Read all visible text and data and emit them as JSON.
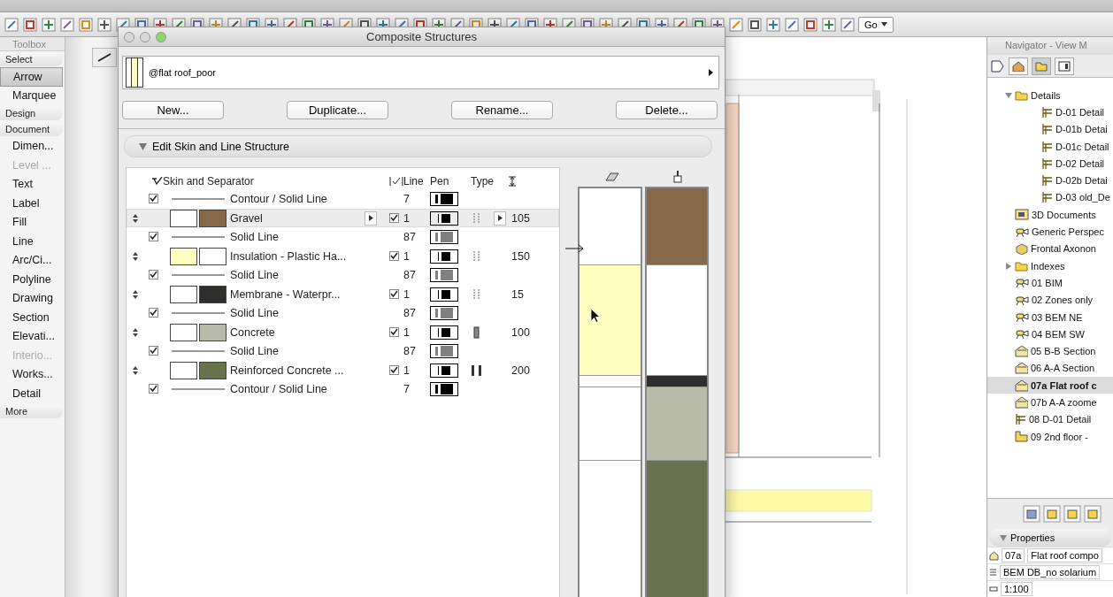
{
  "toolbar": {
    "go_button": "Go"
  },
  "toolbox": {
    "title": "Toolbox",
    "items": [
      {
        "kind": "group",
        "label": "Select"
      },
      {
        "kind": "tool",
        "label": "Arrow",
        "selected": true,
        "disabled": false
      },
      {
        "kind": "tool",
        "label": "Marquee",
        "selected": false,
        "disabled": false
      },
      {
        "kind": "group",
        "label": "Design"
      },
      {
        "kind": "group",
        "label": "Document"
      },
      {
        "kind": "tool",
        "label": "Dimen...",
        "selected": false,
        "disabled": false
      },
      {
        "kind": "tool",
        "label": "Level ...",
        "selected": false,
        "disabled": true
      },
      {
        "kind": "tool",
        "label": "Text",
        "selected": false,
        "disabled": false
      },
      {
        "kind": "tool",
        "label": "Label",
        "selected": false,
        "disabled": false
      },
      {
        "kind": "tool",
        "label": "Fill",
        "selected": false,
        "disabled": false
      },
      {
        "kind": "tool",
        "label": "Line",
        "selected": false,
        "disabled": false
      },
      {
        "kind": "tool",
        "label": "Arc/Ci...",
        "selected": false,
        "disabled": false
      },
      {
        "kind": "tool",
        "label": "Polyline",
        "selected": false,
        "disabled": false
      },
      {
        "kind": "tool",
        "label": "Drawing",
        "selected": false,
        "disabled": false
      },
      {
        "kind": "tool",
        "label": "Section",
        "selected": false,
        "disabled": false
      },
      {
        "kind": "tool",
        "label": "Elevati...",
        "selected": false,
        "disabled": false
      },
      {
        "kind": "tool",
        "label": "Interio...",
        "selected": false,
        "disabled": true
      },
      {
        "kind": "tool",
        "label": "Works...",
        "selected": false,
        "disabled": false
      },
      {
        "kind": "tool",
        "label": "Detail",
        "selected": false,
        "disabled": false
      },
      {
        "kind": "group",
        "label": "More"
      }
    ]
  },
  "dialog": {
    "title": "Composite Structures",
    "structure": "@flat roof_poor",
    "buttons": [
      "New...",
      "Duplicate...",
      "Rename...",
      "Delete..."
    ],
    "section": {
      "label": "Edit Skin and Line Structure",
      "expanded": true
    },
    "columns": {
      "name": "Skin and Separator",
      "line": "Line",
      "pen": "Pen",
      "type": "Type"
    },
    "rows": [
      {
        "kind": "line",
        "name": "Contour /  Solid Line",
        "checked": true,
        "line": "7",
        "pen": {
          "color": "#000000"
        }
      },
      {
        "kind": "skin",
        "name": "Gravel",
        "swatches": [
          {
            "color": "#ffffff"
          },
          {
            "color": "#86694a"
          }
        ],
        "checked": true,
        "line": "1",
        "pen": {
          "color": "#000000"
        },
        "pattern": {
          "kind": "hatch"
        },
        "thickness": "105",
        "selected": true
      },
      {
        "kind": "line",
        "name": "Solid Line",
        "checked": true,
        "line": "87",
        "pen": {
          "color": "#808080"
        }
      },
      {
        "kind": "skin",
        "name": "Insulation - Plastic Ha...",
        "swatches": [
          {
            "color": "#fffec0"
          },
          {
            "color": "#ffffff"
          }
        ],
        "checked": true,
        "line": "1",
        "pen": {
          "color": "#000000"
        },
        "pattern": {
          "kind": "hatch"
        },
        "thickness": "150",
        "selected": false
      },
      {
        "kind": "line",
        "name": "Solid Line",
        "checked": true,
        "line": "87",
        "pen": {
          "color": "#808080"
        }
      },
      {
        "kind": "skin",
        "name": "Membrane - Waterpr...",
        "swatches": [
          {
            "color": "#ffffff"
          },
          {
            "color": "#2e2e2c"
          }
        ],
        "checked": true,
        "line": "1",
        "pen": {
          "color": "#000000"
        },
        "pattern": {
          "kind": "hatch"
        },
        "thickness": "15",
        "selected": false
      },
      {
        "kind": "line",
        "name": "Solid Line",
        "checked": true,
        "line": "87",
        "pen": {
          "color": "#808080"
        }
      },
      {
        "kind": "skin",
        "name": "Concrete",
        "swatches": [
          {
            "color": "#ffffff"
          },
          {
            "color": "#b8baaa"
          }
        ],
        "checked": true,
        "line": "1",
        "pen": {
          "color": "#000000"
        },
        "pattern": {
          "kind": "block"
        },
        "thickness": "100",
        "selected": false
      },
      {
        "kind": "line",
        "name": "Solid Line",
        "checked": true,
        "line": "87",
        "pen": {
          "color": "#808080"
        }
      },
      {
        "kind": "skin",
        "name": "Reinforced Concrete ...",
        "swatches": [
          {
            "color": "#ffffff"
          },
          {
            "color": "#68734e"
          }
        ],
        "checked": true,
        "line": "1",
        "pen": {
          "color": "#000000"
        },
        "pattern": {
          "kind": "bars"
        },
        "thickness": "200",
        "selected": false
      },
      {
        "kind": "line",
        "name": "Contour /  Solid Line",
        "checked": true,
        "line": "7",
        "pen": {
          "color": "#000000"
        }
      }
    ]
  },
  "navigator": {
    "title": "Navigator - View M",
    "tree": [
      {
        "label": "Details",
        "kind": "folder",
        "expanded": true,
        "selected": false,
        "children": [
          {
            "label": "D-01 Detail",
            "kind": "detail",
            "selected": false
          },
          {
            "label": "D-01b Detai",
            "kind": "detail",
            "selected": false
          },
          {
            "label": "D-01c Detail",
            "kind": "detail",
            "selected": false
          },
          {
            "label": "D-02 Detail",
            "kind": "detail",
            "selected": false
          },
          {
            "label": "D-02b Detai",
            "kind": "detail",
            "selected": false
          },
          {
            "label": "D-03 old_De",
            "kind": "detail",
            "selected": false
          }
        ]
      },
      {
        "label": "3D Documents",
        "kind": "document",
        "selected": false
      },
      {
        "label": "Generic Perspec",
        "kind": "camera",
        "selected": false
      },
      {
        "label": "Frontal Axonon",
        "kind": "axon",
        "selected": false
      },
      {
        "label": "Indexes",
        "kind": "folder",
        "expanded": false,
        "selected": false
      },
      {
        "label": "01 BIM",
        "kind": "camera",
        "selected": false
      },
      {
        "label": "02 Zones only",
        "kind": "camera",
        "selected": false
      },
      {
        "label": "03 BEM NE",
        "kind": "camera",
        "selected": false
      },
      {
        "label": "04 BEM SW",
        "kind": "camera",
        "selected": false
      },
      {
        "label": "05 B-B Section",
        "kind": "section",
        "selected": false
      },
      {
        "label": "06 A-A Section",
        "kind": "section",
        "selected": false
      },
      {
        "label": "07a Flat roof c",
        "kind": "section",
        "selected": true
      },
      {
        "label": "07b A-A zoome",
        "kind": "section",
        "selected": false
      },
      {
        "label": "08 D-01 Detail",
        "kind": "detail",
        "selected": false
      },
      {
        "label": "09 2nd floor -",
        "kind": "story",
        "selected": false
      }
    ],
    "properties": {
      "label": "Properties",
      "expanded": true,
      "id": "07a",
      "name": "Flat roof compo",
      "layer": "BEM DB_no solarium",
      "scale": "1:100"
    }
  }
}
